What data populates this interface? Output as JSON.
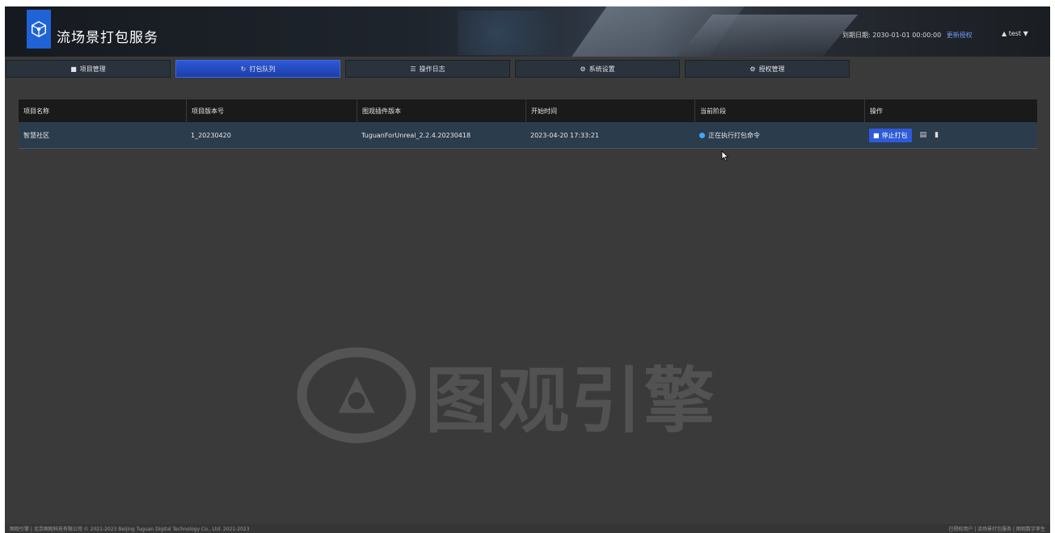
{
  "app": {
    "title": "流场景打包服务",
    "logo_icon": "cube-logo-icon",
    "expire_label": "到期日期: 2030-01-01 00:00:00",
    "renew_link": "更新授权",
    "user_label": "test"
  },
  "tabs": [
    {
      "label": "项目管理",
      "icon": "home-icon"
    },
    {
      "label": "打包队列",
      "icon": "sync-icon",
      "active": true
    },
    {
      "label": "操作日志",
      "icon": "list-icon"
    },
    {
      "label": "系统设置",
      "icon": "gear-icon"
    },
    {
      "label": "授权管理",
      "icon": "gear-icon"
    }
  ],
  "table": {
    "columns": [
      "项目名称",
      "项目版本号",
      "图观插件版本",
      "开始时间",
      "当前阶段",
      "操作"
    ],
    "rows": [
      {
        "project_name": "智慧社区",
        "project_version": "1_20230420",
        "plugin_version": "TuguanForUnreal_2.2.4.20230418",
        "start_time": "2023-04-20 17:33:21",
        "stage": "正在执行打包命令",
        "stop_label": "停止打包"
      }
    ]
  },
  "watermark": {
    "text": "图观引擎"
  },
  "footer": {
    "left": "图观引擎 | 北京图观科技有限公司 © 2021-2023 Beijing Tuguan Digital Technology Co., Ltd. 2021-2023",
    "right": "已授权用户 | 流场景打包服务 | 图观数字孪生"
  },
  "colors": {
    "accent": "#2f5ad8",
    "status_running": "#3fa7ff",
    "background": "#3a3a3a",
    "row_bg": "#2b3c4d",
    "header_bg": "#1a1a1a"
  }
}
